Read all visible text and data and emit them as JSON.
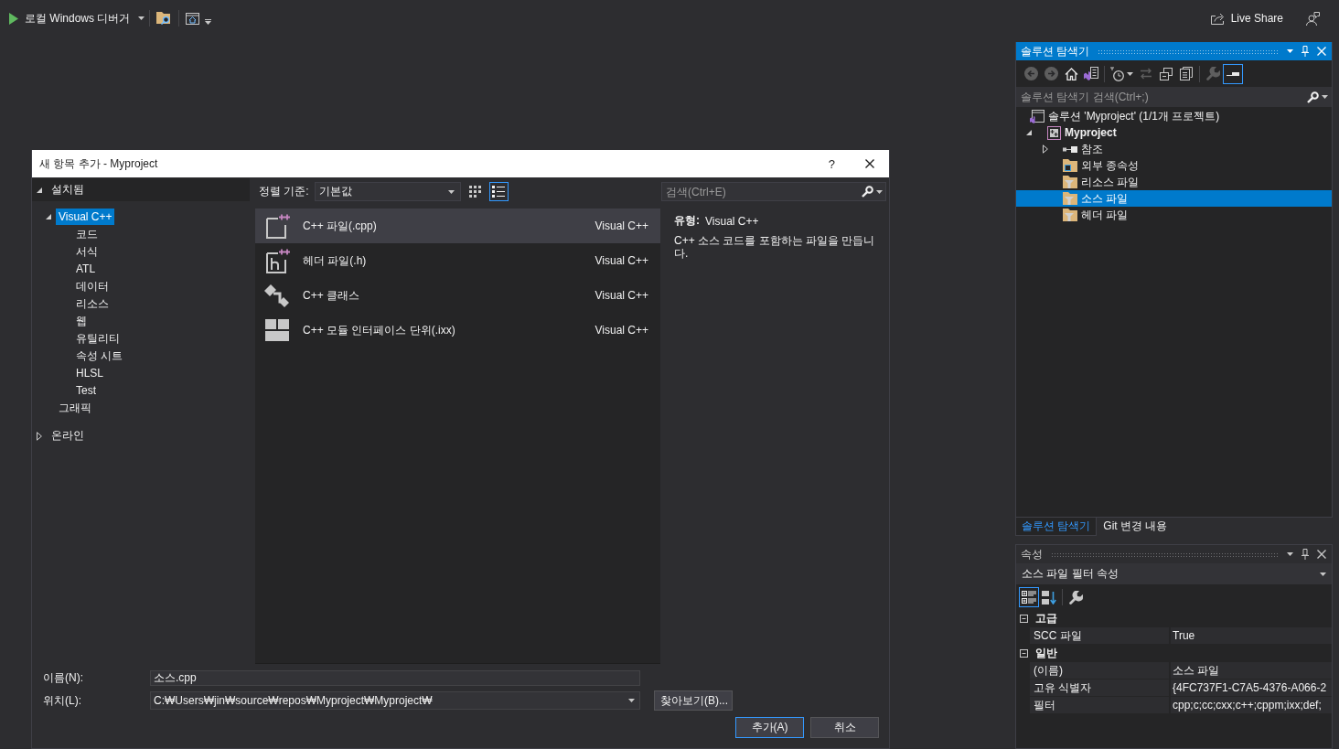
{
  "top_bar": {
    "debugger": "로컬 Windows 디버거",
    "live_share": "Live Share"
  },
  "dialog": {
    "title": "새 항목 추가 - Myproject",
    "help": "?",
    "sections": [
      {
        "label": "설치됨",
        "expanded": true,
        "children": [
          {
            "label": "Visual C++",
            "expanded": true,
            "selected": true,
            "children": [
              {
                "label": "코드",
                "selected": false
              },
              {
                "label": "서식",
                "selected": false
              },
              {
                "label": "ATL",
                "selected": false
              },
              {
                "label": "데이터",
                "selected": false
              },
              {
                "label": "리소스",
                "selected": false
              },
              {
                "label": "웹",
                "selected": false
              },
              {
                "label": "유틸리티",
                "selected": false
              },
              {
                "label": "속성 시트",
                "selected": false
              },
              {
                "label": "HLSL",
                "selected": false
              },
              {
                "label": "Test",
                "selected": false
              }
            ]
          },
          {
            "label": "그래픽",
            "selected": false
          }
        ]
      },
      {
        "label": "온라인",
        "expanded": false
      }
    ],
    "sort": {
      "label": "정렬 기준:",
      "value": "기본값"
    },
    "views": [
      {
        "kind": "grid",
        "selected": false
      },
      {
        "kind": "list",
        "selected": true
      }
    ],
    "search": {
      "placeholder": "검색(Ctrl+E)"
    },
    "templates": [
      {
        "kind": "cpp",
        "name": "C++ 파일(.cpp)",
        "category": "Visual C++",
        "selected": true
      },
      {
        "kind": "header",
        "name": "헤더 파일(.h)",
        "category": "Visual C++",
        "selected": false
      },
      {
        "kind": "class",
        "name": "C++ 클래스",
        "category": "Visual C++",
        "selected": false
      },
      {
        "kind": "module",
        "name": "C++ 모듈 인터페이스 단위(.ixx)",
        "category": "Visual C++",
        "selected": false
      }
    ],
    "details": {
      "type_label": "유형:",
      "type_value": "Visual C++",
      "description": "C++ 소스 코드를 포함하는 파일을 만듭니다."
    },
    "name": {
      "label": "이름(N):",
      "value": "소스.cpp"
    },
    "location": {
      "label": "위치(L):",
      "value": "C:₩Users₩jin₩source₩repos₩Myproject₩Myproject₩"
    },
    "buttons": [
      {
        "kind": "browse",
        "label": "찾아보기(B)..."
      },
      {
        "kind": "default",
        "label": "추가(A)"
      },
      {
        "kind": "cancel",
        "label": "취소"
      }
    ]
  },
  "solution_explorer": {
    "title": "솔루션 탐색기",
    "active": true,
    "toolbar_groups": [
      {
        "buttons": [
          {
            "kind": "back",
            "disabled": true,
            "selected": false
          },
          {
            "kind": "forward",
            "disabled": true,
            "selected": false
          },
          {
            "kind": "home",
            "disabled": false,
            "selected": false
          },
          {
            "kind": "switch-views",
            "disabled": false,
            "selected": false
          }
        ]
      },
      {
        "buttons": [
          {
            "kind": "history",
            "disabled": false,
            "selected": false
          },
          {
            "kind": "sync",
            "disabled": true,
            "selected": false
          },
          {
            "kind": "collapse",
            "disabled": false,
            "selected": false
          },
          {
            "kind": "show-all",
            "disabled": false,
            "selected": false
          }
        ]
      },
      {
        "buttons": [
          {
            "kind": "properties",
            "disabled": true,
            "selected": false
          },
          {
            "kind": "preview",
            "disabled": false,
            "selected": true
          }
        ]
      }
    ],
    "search": {
      "placeholder": "솔루션 탐색기 검색(Ctrl+;)"
    },
    "tree": [
      {
        "kind": "solution",
        "label": "솔루션 'Myproject' (1/1개 프로젝트)",
        "selected": false,
        "children": [
          {
            "kind": "project",
            "label": "Myproject",
            "expanded": true,
            "selected": false,
            "children": [
              {
                "kind": "references",
                "label": "참조",
                "expanded": false,
                "selected": false
              },
              {
                "kind": "external",
                "label": "외부 종속성",
                "selected": false
              },
              {
                "kind": "filter",
                "label": "리소스 파일",
                "selected": false
              },
              {
                "kind": "filter",
                "label": "소스 파일",
                "selected": true
              },
              {
                "kind": "filter",
                "label": "헤더 파일",
                "selected": false
              }
            ]
          }
        ]
      }
    ]
  },
  "panel_tabs": [
    {
      "label": "솔루션 탐색기",
      "selected": true
    },
    {
      "label": "Git 변경 내용",
      "selected": false
    }
  ],
  "properties": {
    "title": "속성",
    "active": false,
    "object": "소스 파일 필터 속성",
    "toolbar_groups": [
      {
        "buttons": [
          {
            "kind": "categorized",
            "selected": true
          },
          {
            "kind": "alphabetical",
            "selected": false
          }
        ]
      },
      {
        "buttons": [
          {
            "kind": "property-pages",
            "selected": false
          }
        ]
      }
    ],
    "categories": [
      {
        "label": "고급",
        "expanded": true,
        "rows": [
          {
            "name": "SCC 파일",
            "value": "True"
          }
        ]
      },
      {
        "label": "일반",
        "expanded": true,
        "rows": [
          {
            "name": "(이름)",
            "value": "소스 파일"
          },
          {
            "name": "고유 식별자",
            "value": "{4FC737F1-C7A5-4376-A066-2"
          },
          {
            "name": "필터",
            "value": "cpp;c;cc;cxx;c++;cppm;ixx;def;"
          }
        ]
      }
    ]
  }
}
